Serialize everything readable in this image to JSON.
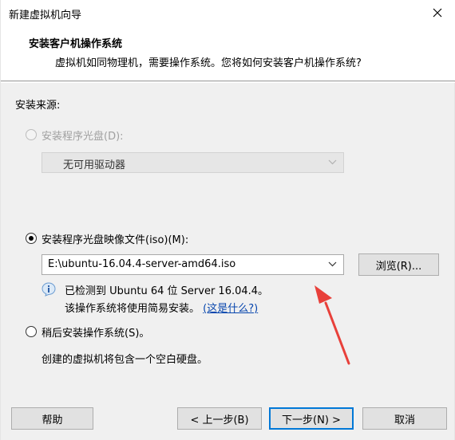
{
  "window": {
    "title": "新建虚拟机向导"
  },
  "header": {
    "title": "安装客户机操作系统",
    "subtitle": "虚拟机如同物理机，需要操作系统。您将如何安装客户机操作系统?"
  },
  "source": {
    "label": "安装来源:",
    "disc_option": {
      "label": "安装程序光盘(D):",
      "selected": false,
      "enabled": false,
      "drive_value": "无可用驱动器"
    },
    "iso_option": {
      "label": "安装程序光盘映像文件(iso)(M):",
      "selected": true,
      "path_value": "E:\\ubuntu-16.04.4-server-amd64.iso",
      "browse_label": "浏览(R)...",
      "detected_text": "已检测到 Ubuntu 64 位 Server 16.04.4。",
      "easy_install_text": "该操作系统将使用简易安装。",
      "whats_this_link": "(这是什么?)"
    },
    "later_option": {
      "label": "稍后安装操作系统(S)。",
      "selected": false,
      "description": "创建的虚拟机将包含一个空白硬盘。"
    }
  },
  "footer": {
    "help_label": "帮助",
    "back_label": "< 上一步(B)",
    "next_label": "下一步(N) >",
    "cancel_label": "取消"
  },
  "colors": {
    "accent": "#0078d7",
    "link": "#0645ad",
    "annotation_arrow": "#e8403a"
  },
  "icons": {
    "close": "close-icon",
    "info": "info-icon",
    "dropdown": "chevron-down-icon"
  }
}
